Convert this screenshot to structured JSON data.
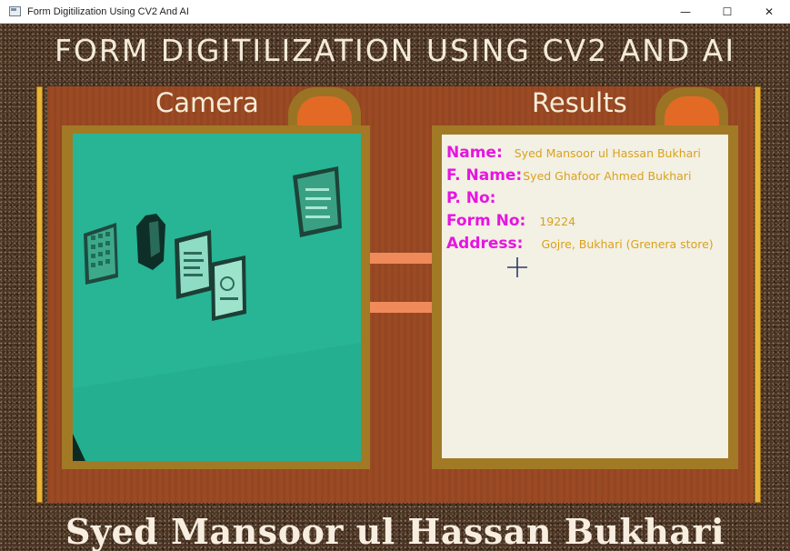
{
  "window": {
    "title": "Form Digitilization Using CV2 And AI",
    "controls": {
      "minimize": "—",
      "maximize": "☐",
      "close": "✕"
    }
  },
  "app": {
    "title": "FORM DIGITILIZATION USING CV2 AND AI",
    "footer_name": "Syed Mansoor ul Hassan Bukhari",
    "colors": {
      "board": "#9b4a24",
      "frame": "#a27a26",
      "camera_tint": "#2ab899",
      "label_magenta": "#e615e0",
      "value_gold": "#d9a21c",
      "connector": "#f08a5a",
      "rail": "#e7b43a"
    }
  },
  "camera": {
    "label": "Camera"
  },
  "results": {
    "label": "Results",
    "fields": [
      {
        "label": "Name:",
        "value": "Syed Mansoor ul Hassan Bukhari"
      },
      {
        "label": "F. Name:",
        "value": "Syed Ghafoor Ahmed Bukhari"
      },
      {
        "label": "P. No:",
        "value": ""
      },
      {
        "label": "Form No:",
        "value": "19224"
      },
      {
        "label": "Address:",
        "value": "Gojre, Bukhari (Grenera store)"
      }
    ]
  },
  "icons": {
    "app": "window-app-icon",
    "cursor": "crosshair-cursor-icon"
  }
}
